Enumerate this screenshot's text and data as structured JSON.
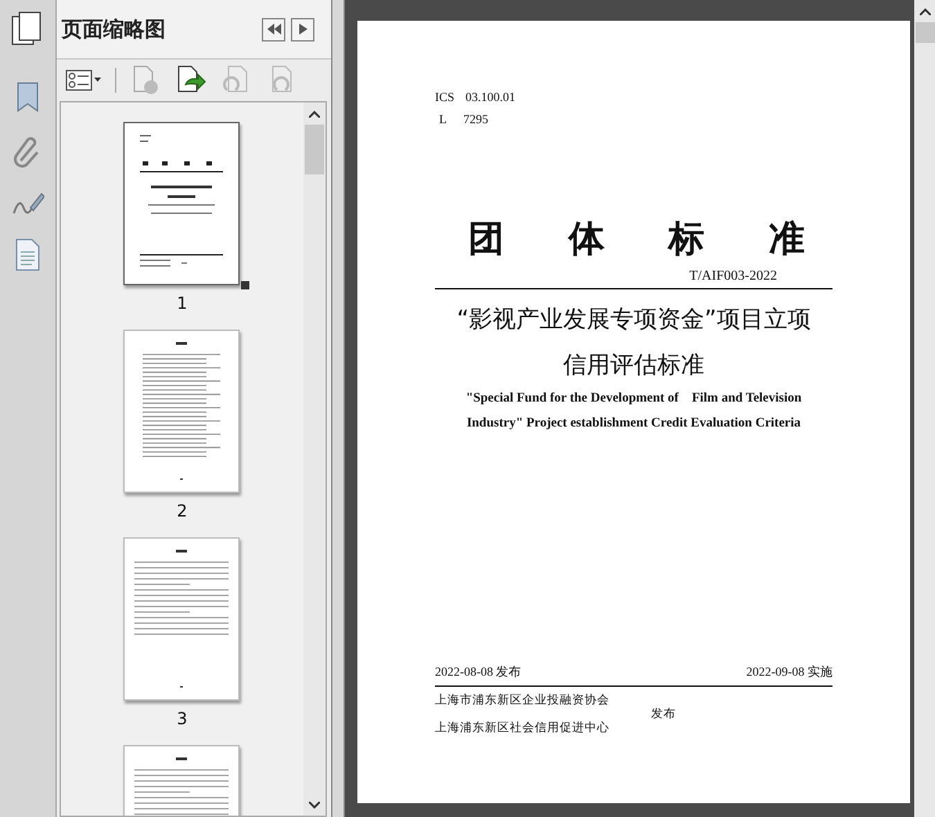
{
  "panel": {
    "title": "页面缩略图"
  },
  "thumbnails": [
    {
      "label": "1",
      "kind": "cover",
      "selected": true
    },
    {
      "label": "2",
      "kind": "toc",
      "selected": false
    },
    {
      "label": "3",
      "kind": "text",
      "selected": false
    },
    {
      "kind": "text",
      "selected": false
    }
  ],
  "document": {
    "ics_label": "ICS",
    "ics_value": "03.100.01",
    "l_label": "L",
    "l_value": "7295",
    "heading": [
      "团",
      "体",
      "标",
      "准"
    ],
    "code": "T/AIF003-2022",
    "title_cn": [
      "“影视产业发展专项资金”项目立项",
      "信用评估标准"
    ],
    "title_en": [
      "\"Special Fund for the Development of    Film and Television",
      "Industry\" Project establishment Credit Evaluation Criteria"
    ],
    "publish_date": "2022-08-08 发布",
    "effective_date": "2022-09-08  实施",
    "issuers": [
      "上海市浦东新区企业投融资协会",
      "上海浦东新区社会信用促进中心"
    ],
    "issued": "发布"
  }
}
